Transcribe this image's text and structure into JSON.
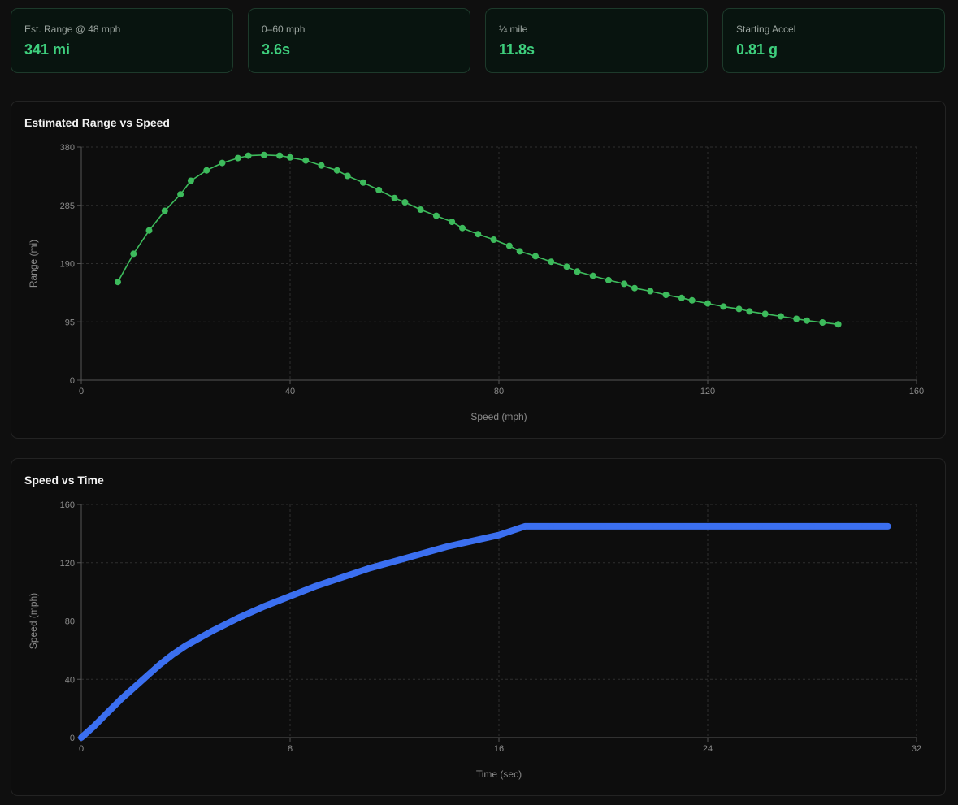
{
  "stats": [
    {
      "label": "Est. Range @ 48 mph",
      "value": "341 mi"
    },
    {
      "label": "0–60 mph",
      "value": "3.6s"
    },
    {
      "label": "¼ mile",
      "value": "11.8s"
    },
    {
      "label": "Starting Accel",
      "value": "0.81 g"
    }
  ],
  "colors": {
    "accent": "#3ecf7d",
    "range_series": "#3dbb5c",
    "speed_series": "#3b6ff0"
  },
  "chart_data": [
    {
      "type": "line",
      "title": "Estimated Range vs Speed",
      "xlabel": "Speed (mph)",
      "ylabel": "Range (mi)",
      "xlim": [
        0,
        160
      ],
      "ylim": [
        0,
        380
      ],
      "xticks": [
        0,
        40,
        80,
        120,
        160
      ],
      "yticks": [
        0,
        95,
        190,
        285,
        380
      ],
      "grid": true,
      "markers": true,
      "x": [
        7,
        10,
        13,
        16,
        19,
        21,
        24,
        27,
        30,
        32,
        35,
        38,
        40,
        43,
        46,
        49,
        51,
        54,
        57,
        60,
        62,
        65,
        68,
        71,
        73,
        76,
        79,
        82,
        84,
        87,
        90,
        93,
        95,
        98,
        101,
        104,
        106,
        109,
        112,
        115,
        117,
        120,
        123,
        126,
        128,
        131,
        134,
        137,
        139,
        142,
        145
      ],
      "y": [
        160,
        206,
        244,
        276,
        303,
        325,
        342,
        354,
        362,
        366,
        367,
        366,
        363,
        358,
        350,
        342,
        333,
        322,
        310,
        297,
        290,
        278,
        268,
        258,
        248,
        238,
        229,
        219,
        210,
        202,
        193,
        185,
        177,
        170,
        163,
        157,
        150,
        145,
        139,
        134,
        130,
        125,
        120,
        116,
        112,
        108,
        104,
        100,
        97,
        94,
        91
      ]
    },
    {
      "type": "line",
      "title": "Speed vs Time",
      "xlabel": "Time (sec)",
      "ylabel": "Speed (mph)",
      "xlim": [
        0,
        32
      ],
      "ylim": [
        0,
        160
      ],
      "xticks": [
        0,
        8,
        16,
        24,
        32
      ],
      "yticks": [
        0,
        40,
        80,
        120,
        160
      ],
      "grid": true,
      "markers": true,
      "x": [
        0,
        0.5,
        1,
        1.5,
        2,
        2.5,
        3,
        3.5,
        4,
        4.5,
        5,
        6,
        7,
        8,
        9,
        10,
        11,
        12,
        13,
        14,
        15,
        16,
        17,
        18,
        19,
        20,
        21,
        22,
        23,
        24,
        25,
        26,
        27,
        28,
        29,
        30,
        30.9
      ],
      "y": [
        0,
        8,
        17,
        26,
        34,
        42,
        50,
        57,
        63,
        68,
        73,
        82,
        90,
        97,
        104,
        110,
        116,
        121,
        126,
        131,
        135,
        139,
        145,
        145,
        145,
        145,
        145,
        145,
        145,
        145,
        145,
        145,
        145,
        145,
        145,
        145,
        145
      ]
    }
  ]
}
